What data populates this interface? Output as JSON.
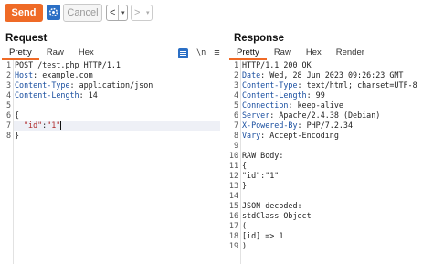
{
  "toolbar": {
    "send_label": "Send",
    "cancel_label": "Cancel",
    "back_arrow": "<",
    "forward_arrow": ">",
    "dropdown_glyph": "▾"
  },
  "request": {
    "title": "Request",
    "tabs": [
      "Pretty",
      "Raw",
      "Hex"
    ],
    "active_tab": "Pretty",
    "icons": [
      "list-icon",
      "newline-icon",
      "menu-icon"
    ],
    "newline_glyph": "\\n",
    "menu_glyph": "≡",
    "lines": [
      {
        "n": "1",
        "text": "POST /test.php HTTP/1.1"
      },
      {
        "n": "2",
        "key": "Host",
        "text": ": example.com"
      },
      {
        "n": "3",
        "key": "Content-Type",
        "text": ": application/json"
      },
      {
        "n": "4",
        "key": "Content-Length",
        "text": ": 14"
      },
      {
        "n": "5",
        "text": ""
      },
      {
        "n": "6",
        "text": "{"
      },
      {
        "n": "7",
        "str1": "\"id\"",
        "mid": ":",
        "str2": "\"1\""
      },
      {
        "n": "8",
        "text": "}"
      }
    ]
  },
  "response": {
    "title": "Response",
    "tabs": [
      "Pretty",
      "Raw",
      "Hex",
      "Render"
    ],
    "active_tab": "Pretty",
    "lines": [
      {
        "n": "1",
        "text": "HTTP/1.1 200 OK"
      },
      {
        "n": "2",
        "key": "Date",
        "text": ": Wed, 28 Jun 2023 09:26:23 GMT"
      },
      {
        "n": "3",
        "key": "Content-Type",
        "text": ": text/html; charset=UTF-8"
      },
      {
        "n": "4",
        "key": "Content-Length",
        "text": ": 99"
      },
      {
        "n": "5",
        "key": "Connection",
        "text": ": keep-alive"
      },
      {
        "n": "6",
        "key": "Server",
        "text": ": Apache/2.4.38 (Debian)"
      },
      {
        "n": "7",
        "key": "X-Powered-By",
        "text": ": PHP/7.2.34"
      },
      {
        "n": "8",
        "key": "Vary",
        "text": ": Accept-Encoding"
      },
      {
        "n": "9",
        "text": ""
      },
      {
        "n": "10",
        "text": "RAW Body:"
      },
      {
        "n": "11",
        "text": "{"
      },
      {
        "n": "12",
        "text": "\"id\":\"1\""
      },
      {
        "n": "13",
        "text": "}"
      },
      {
        "n": "14",
        "text": ""
      },
      {
        "n": "15",
        "text": "JSON decoded:"
      },
      {
        "n": "16",
        "text": "stdClass Object"
      },
      {
        "n": "17",
        "text": "("
      },
      {
        "n": "18",
        "text": "[id] => 1"
      },
      {
        "n": "19",
        "text": ")"
      }
    ]
  }
}
